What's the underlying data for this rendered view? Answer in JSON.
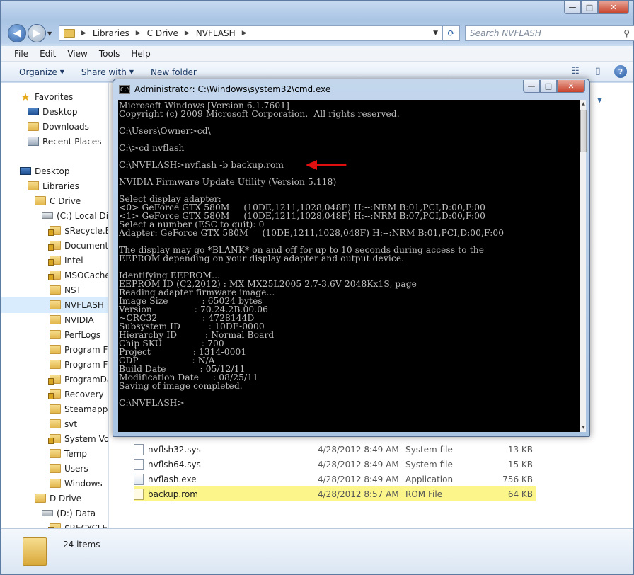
{
  "explorer": {
    "window_controls": {
      "minimize": "—",
      "maximize": "□",
      "close": "✕"
    },
    "breadcrumb": [
      "Libraries",
      "C Drive",
      "NVFLASH"
    ],
    "search_placeholder": "Search NVFLASH",
    "menu": [
      "File",
      "Edit",
      "View",
      "Tools",
      "Help"
    ],
    "toolbar": {
      "organize": "Organize",
      "share_with": "Share with",
      "new_folder": "New folder"
    },
    "nav_tree": [
      {
        "label": "Favorites",
        "icon": "star-icon"
      },
      {
        "label": "Desktop",
        "icon": "desktop-icon"
      },
      {
        "label": "Downloads",
        "icon": "folder-icon"
      },
      {
        "label": "Recent Places",
        "icon": "recent-places-icon"
      },
      {
        "label": "Desktop",
        "icon": "desktop-icon"
      },
      {
        "label": "Libraries",
        "icon": "libraries-icon"
      },
      {
        "label": "C Drive",
        "icon": "folder-icon"
      },
      {
        "label": "(C:) Local Dis",
        "icon": "drive-icon"
      },
      {
        "label": "$Recycle.Bi",
        "icon": "locked-folder-icon"
      },
      {
        "label": "Document",
        "icon": "locked-folder-icon"
      },
      {
        "label": "Intel",
        "icon": "locked-folder-icon"
      },
      {
        "label": "MSOCache",
        "icon": "locked-folder-icon"
      },
      {
        "label": "NST",
        "icon": "folder-icon"
      },
      {
        "label": "NVFLASH",
        "icon": "folder-icon"
      },
      {
        "label": "NVIDIA",
        "icon": "folder-icon"
      },
      {
        "label": "PerfLogs",
        "icon": "folder-icon"
      },
      {
        "label": "Program Fi",
        "icon": "folder-icon"
      },
      {
        "label": "Program Fi",
        "icon": "folder-icon"
      },
      {
        "label": "ProgramDa",
        "icon": "locked-folder-icon"
      },
      {
        "label": "Recovery",
        "icon": "locked-folder-icon"
      },
      {
        "label": "Steamapps",
        "icon": "folder-icon"
      },
      {
        "label": "svt",
        "icon": "folder-icon"
      },
      {
        "label": "System Vol",
        "icon": "locked-folder-icon"
      },
      {
        "label": "Temp",
        "icon": "folder-icon"
      },
      {
        "label": "Users",
        "icon": "folder-icon"
      },
      {
        "label": "Windows",
        "icon": "folder-icon"
      },
      {
        "label": "D Drive",
        "icon": "folder-icon"
      },
      {
        "label": "(D:) Data",
        "icon": "drive-icon"
      },
      {
        "label": "$RECYCLE.I",
        "icon": "locked-folder-icon"
      }
    ],
    "files": [
      {
        "name": "nvflsh32.sys",
        "date": "4/28/2012 8:49 AM",
        "type": "System file",
        "size": "13 KB"
      },
      {
        "name": "nvflsh64.sys",
        "date": "4/28/2012 8:49 AM",
        "type": "System file",
        "size": "15 KB"
      },
      {
        "name": "nvflash.exe",
        "date": "4/28/2012 8:49 AM",
        "type": "Application",
        "size": "756 KB"
      },
      {
        "name": "backup.rom",
        "date": "4/28/2012 8:57 AM",
        "type": "ROM File",
        "size": "64 KB"
      }
    ],
    "status": {
      "item_count": "24 items"
    }
  },
  "cmd": {
    "title": "Administrator: C:\\Windows\\system32\\cmd.exe",
    "output": "Microsoft Windows [Version 6.1.7601]\nCopyright (c) 2009 Microsoft Corporation.  All rights reserved.\n\nC:\\Users\\Owner>cd\\\n\nC:\\>cd nvflash\n\nC:\\NVFLASH>nvflash -b backup.rom\n\nNVIDIA Firmware Update Utility (Version 5.118)\n\nSelect display adapter:\n<0> GeForce GTX 580M     (10DE,1211,1028,048F) H:--:NRM B:01,PCI,D:00,F:00\n<1> GeForce GTX 580M     (10DE,1211,1028,048F) H:--:NRM B:07,PCI,D:00,F:00\nSelect a number (ESC to quit): 0\nAdapter: GeForce GTX 580M     (10DE,1211,1028,048F) H:--:NRM B:01,PCI,D:00,F:00\n\nThe display may go *BLANK* on and off for up to 10 seconds during access to the\nEEPROM depending on your display adapter and output device.\n\nIdentifying EEPROM...\nEEPROM ID (C2,2012) : MX MX25L2005 2.7-3.6V 2048Kx1S, page\nReading adapter firmware image...\nImage Size            : 65024 bytes\nVersion               : 70.24.2B.00.06\n~CRC32                : 4728144D\nSubsystem ID          : 10DE-0000\nHierarchy ID          : Normal Board\nChip SKU              : 700\nProject               : 1314-0001\nCDP                   : N/A\nBuild Date            : 05/12/11\nModification Date     : 08/25/11\nSaving of image completed.\n\nC:\\NVFLASH>",
    "annotation_color": "#e01010"
  }
}
